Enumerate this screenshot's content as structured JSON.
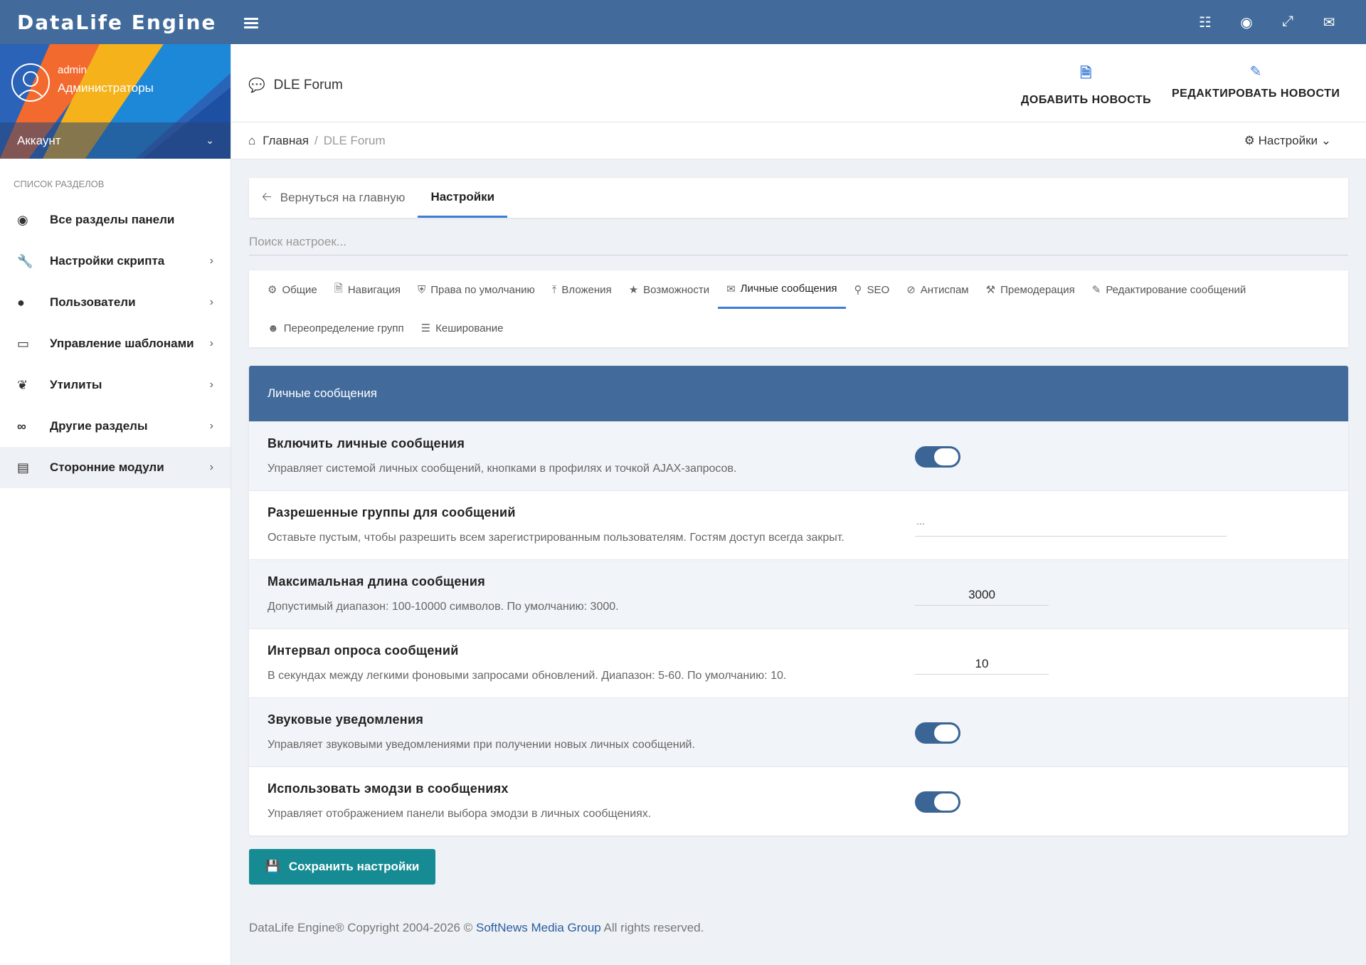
{
  "header": {
    "brand": "DataLife Engine",
    "icons": [
      "translate-icon",
      "globe-icon",
      "fullscreen-icon",
      "mail-icon"
    ]
  },
  "sidebar": {
    "user": {
      "name": "admin",
      "group": "Администраторы"
    },
    "account_label": "Аккаунт",
    "section_title": "Список разделов",
    "items": [
      {
        "label": "Все разделы панели",
        "icon": "globe-icon",
        "has_arrow": false
      },
      {
        "label": "Настройки скрипта",
        "icon": "wrench-icon",
        "has_arrow": true
      },
      {
        "label": "Пользователи",
        "icon": "user-icon",
        "has_arrow": true
      },
      {
        "label": "Управление шаблонами",
        "icon": "laptop-icon",
        "has_arrow": true
      },
      {
        "label": "Утилиты",
        "icon": "leaf-icon",
        "has_arrow": true
      },
      {
        "label": "Другие разделы",
        "icon": "link-icon",
        "has_arrow": true
      },
      {
        "label": "Сторонние модули",
        "icon": "list-icon",
        "has_arrow": true,
        "active": true
      }
    ]
  },
  "page": {
    "title": "DLE Forum",
    "add_news": "ДОБАВИТЬ НОВОСТЬ",
    "edit_news": "РЕДАКТИРОВАТЬ НОВОСТИ"
  },
  "breadcrumb": {
    "home": "Главная",
    "separator": "/",
    "current": "DLE Forum",
    "settings": "Настройки"
  },
  "tabs": {
    "back": "Вернуться на главную",
    "settings": "Настройки"
  },
  "search": {
    "placeholder": "Поиск настроек..."
  },
  "categories": {
    "row1": [
      {
        "label": "Общие",
        "icon": "gear-icon"
      },
      {
        "label": "Навигация",
        "icon": "file-icon"
      },
      {
        "label": "Права по умолчанию",
        "icon": "shield-icon"
      },
      {
        "label": "Вложения",
        "icon": "upload-icon"
      },
      {
        "label": "Возможности",
        "icon": "star-icon"
      },
      {
        "label": "Личные сообщения",
        "icon": "envelope-icon",
        "active": true
      },
      {
        "label": "SEO",
        "icon": "search-icon"
      },
      {
        "label": "Антиспам",
        "icon": "ban-icon"
      },
      {
        "label": "Премодерация",
        "icon": "gavel-icon"
      },
      {
        "label": "Редактирование сообщений",
        "icon": "pencil-icon"
      }
    ],
    "row2": [
      {
        "label": "Переопределение групп",
        "icon": "users-icon"
      },
      {
        "label": "Кеширование",
        "icon": "server-icon"
      }
    ]
  },
  "panel": {
    "title": "Личные сообщения",
    "rows": [
      {
        "title": "Включить личные сообщения",
        "desc": "Управляет системой личных сообщений, кнопками в профилях и точкой AJAX-запросов.",
        "control": "toggle",
        "on": true
      },
      {
        "title": "Разрешенные группы для сообщений",
        "desc": "Оставьте пустым, чтобы разрешить всем зарегистрированным пользователям. Гостям доступ всегда закрыт.",
        "control": "select",
        "value": "..."
      },
      {
        "title": "Максимальная длина сообщения",
        "desc": "Допустимый диапазон: 100-10000 символов. По умолчанию: 3000.",
        "control": "input",
        "value": "3000"
      },
      {
        "title": "Интервал опроса сообщений",
        "desc": "В секундах между легкими фоновыми запросами обновлений. Диапазон: 5-60. По умолчанию: 10.",
        "control": "input",
        "value": "10"
      },
      {
        "title": "Звуковые уведомления",
        "desc": "Управляет звуковыми уведомлениями при получении новых личных сообщений.",
        "control": "toggle",
        "on": true
      },
      {
        "title": "Использовать эмодзи в сообщениях",
        "desc": "Управляет отображением панели выбора эмодзи в личных сообщениях.",
        "control": "toggle",
        "on": true
      }
    ]
  },
  "save_label": "Сохранить настройки",
  "footer": {
    "prefix": "DataLife Engine® Copyright 2004-2026 ©",
    "link": "SoftNews Media Group",
    "suffix": "All rights reserved."
  },
  "colors": {
    "topbar": "#426b9c",
    "accent": "#3b7dd8",
    "save_button": "#168b93",
    "toggle_on": "#3a6595"
  }
}
